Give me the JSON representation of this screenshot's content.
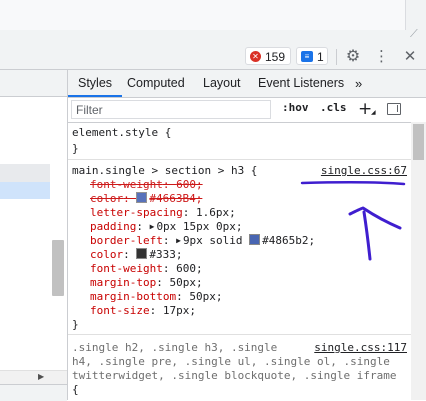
{
  "toolbar": {
    "errors_count": "159",
    "issues_count": "1",
    "errors_icon": "error-circle-icon",
    "issues_icon": "issues-message-icon",
    "settings_icon": "gear-icon",
    "more_icon": "kebab-menu-icon",
    "close_icon": "close-icon"
  },
  "tabs": [
    "Styles",
    "Computed",
    "Layout",
    "Event Listeners",
    "»"
  ],
  "filter": {
    "placeholder": "Filter",
    "hov": ":hov",
    "cls": ".cls",
    "new_rule": "+"
  },
  "element_style": {
    "selector": "element.style {",
    "close": "}"
  },
  "rule_h3": {
    "selector": "main.single > section > h3 {",
    "source": "single.css:67",
    "properties": [
      {
        "name": "font-weight",
        "value": "600;",
        "struck": true
      },
      {
        "name": "color",
        "value": "#4663B4;",
        "struck": true,
        "swatch": "#4663b4"
      },
      {
        "name": "letter-spacing",
        "value": "1.6px;"
      },
      {
        "name": "padding",
        "value": "0px 15px 0px;",
        "expandable": true
      },
      {
        "name": "border-left",
        "value": "9px solid",
        "expandable": true,
        "swatch": "#4865b2",
        "value2": "#4865b2;"
      },
      {
        "name": "color",
        "value": "#333;",
        "swatch": "#333333"
      },
      {
        "name": "font-weight",
        "value": "600;"
      },
      {
        "name": "margin-top",
        "value": "50px;"
      },
      {
        "name": "margin-bottom",
        "value": "50px;"
      },
      {
        "name": "font-size",
        "value": "17px;"
      }
    ],
    "close": "}"
  },
  "rule_next": {
    "selector_lines": [
      ".single h2, .single h3, .single",
      "h4, .single pre, .single ul, .single ol, .single",
      "twitterwidget, .single blockquote, .single iframe",
      "{"
    ],
    "source": "single.css:117"
  },
  "colors": {
    "accent": "#1a73e8",
    "error": "#d93025",
    "annotation": "#3f1ecf",
    "property_name": "#c80000"
  }
}
